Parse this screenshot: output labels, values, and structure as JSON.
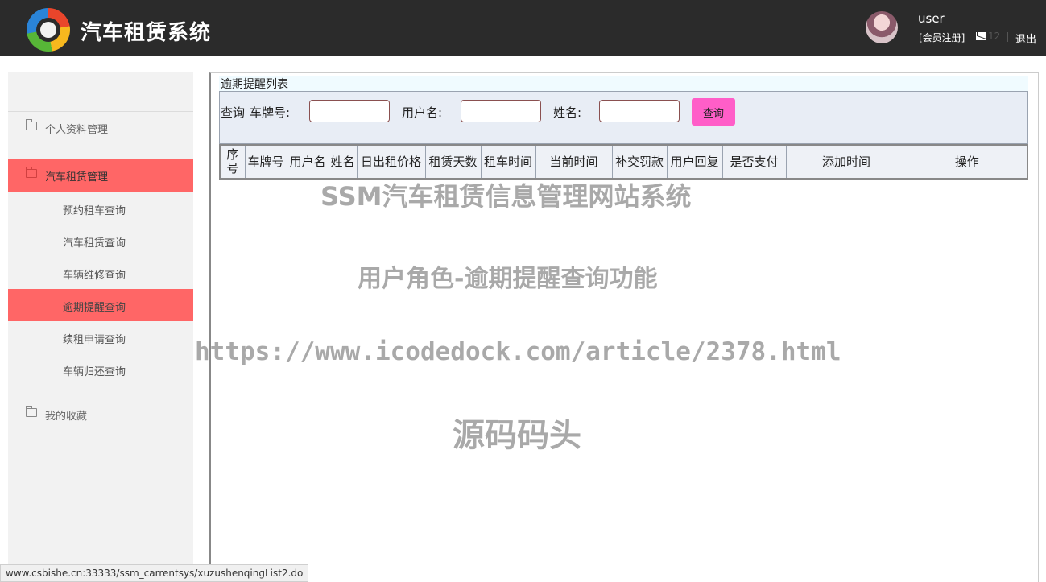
{
  "header": {
    "app_title": "汽车租赁系统",
    "username": "user",
    "register": "[会员注册]",
    "mail_count": "12",
    "logout": "退出"
  },
  "sidebar": {
    "menu_profile": "个人资料管理",
    "menu_rental": "汽车租赁管理",
    "sub_items": [
      "预约租车查询",
      "汽车租赁查询",
      "车辆维修查询",
      "逾期提醒查询",
      "续租申请查询",
      "车辆归还查询"
    ],
    "menu_favorites": "我的收藏"
  },
  "main": {
    "panel_title": "逾期提醒列表",
    "search": {
      "label_query": "查询",
      "label_plate": "车牌号:",
      "label_user": "用户名:",
      "label_name": "姓名:",
      "button": "查询"
    },
    "columns": [
      "序号",
      "车牌号",
      "用户名",
      "姓名",
      "日出租价格",
      "租赁天数",
      "租车时间",
      "当前时间",
      "补交罚款",
      "用户回复",
      "是否支付",
      "添加时间",
      "操作"
    ]
  },
  "watermarks": {
    "line1": "SSM汽车租赁信息管理网站系统",
    "line2": "用户角色-逾期提醒查询功能",
    "line3": "https://www.icodedock.com/article/2378.html",
    "line4": "源码码头"
  },
  "statusbar": "www.csbishe.cn:33333/ssm_carrentsys/xuzushenqingList2.do",
  "colors": {
    "header_bg": "#2b2b2b",
    "active_menu": "#ff6666",
    "search_button": "#ff5ec8"
  }
}
